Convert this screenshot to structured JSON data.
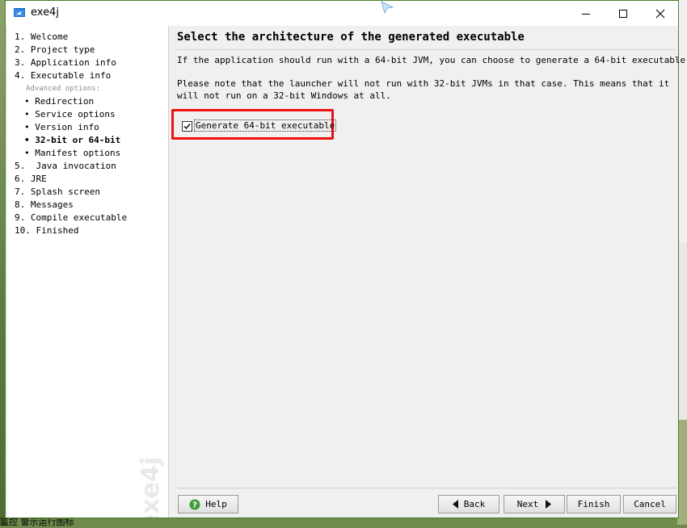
{
  "window": {
    "title": "exe4j"
  },
  "sidebar": {
    "steps": [
      {
        "label": "1. Welcome"
      },
      {
        "label": "2. Project type"
      },
      {
        "label": "3. Application info"
      },
      {
        "label": "4. Executable info"
      }
    ],
    "advanced_label": "Advanced options:",
    "sub_steps": [
      {
        "label": "• Redirection"
      },
      {
        "label": "• Service options"
      },
      {
        "label": "• Version info"
      },
      {
        "label": "• 32-bit or 64-bit",
        "current": true
      },
      {
        "label": "• Manifest options"
      }
    ],
    "steps_after": [
      {
        "label": "5.  Java invocation"
      },
      {
        "label": "6. JRE"
      },
      {
        "label": "7. Splash screen"
      },
      {
        "label": "8. Messages"
      },
      {
        "label": "9. Compile executable"
      },
      {
        "label": "10. Finished"
      }
    ],
    "watermark": "exe4j"
  },
  "main": {
    "heading": "Select the architecture of the generated executable",
    "paragraph1": "If the application should run with a 64-bit JVM, you can choose to generate a 64-bit executable.",
    "paragraph2": "Please note that the launcher will not run with 32-bit JVMs in that case. This means that it will not run on a 32-bit Windows at all.",
    "checkbox": {
      "label": "Generate 64-bit executable",
      "checked": true
    }
  },
  "buttons": {
    "help": "Help",
    "back": "Back",
    "next": "Next",
    "finish": "Finish",
    "cancel": "Cancel"
  },
  "colors": {
    "highlight": "#ee1111",
    "window_border": "#4a7d2b",
    "help_icon": "#3f9d3a"
  },
  "desktop": {
    "taskbar_text": "监控 警示运行图标"
  }
}
